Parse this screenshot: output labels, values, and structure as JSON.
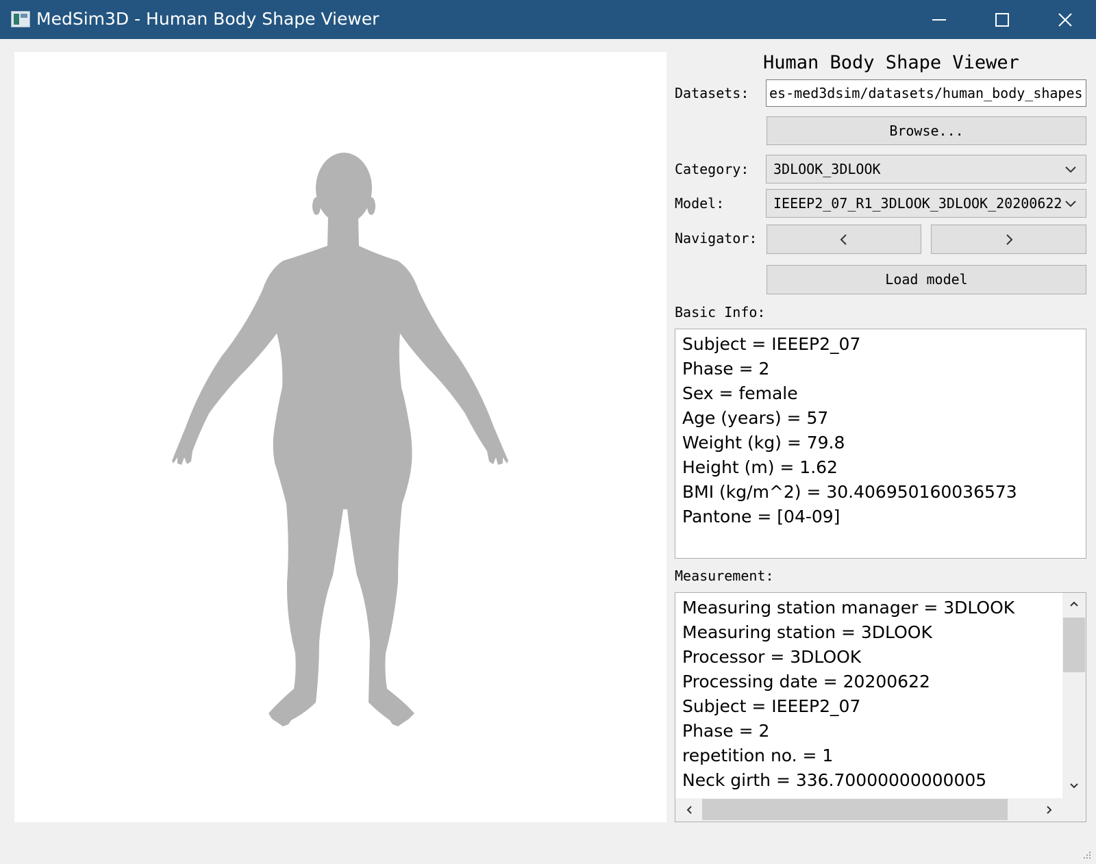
{
  "window": {
    "title": "MedSim3D - Human Body Shape Viewer",
    "titlebar_color": "#235580"
  },
  "panel": {
    "title": "Human Body Shape Viewer",
    "datasets_label": "Datasets:",
    "datasets_value": "es-med3dsim/datasets/human_body_shapes",
    "browse_label": "Browse...",
    "category_label": "Category:",
    "category_value": "3DLOOK_3DLOOK",
    "model_label": "Model:",
    "model_value": "IEEEP2_07_R1_3DLOOK_3DLOOK_20200622",
    "navigator_label": "Navigator:",
    "prev_label": "<",
    "next_label": ">",
    "load_label": "Load model"
  },
  "basic_info": {
    "label": "Basic Info:",
    "lines": [
      "Subject = IEEEP2_07",
      "Phase = 2",
      "Sex = female",
      "Age (years) = 57",
      "Weight (kg) = 79.8",
      "Height (m) = 1.62",
      "BMI (kg/m^2) = 30.406950160036573",
      "Pantone = [04-09]"
    ]
  },
  "measurement": {
    "label": "Measurement:",
    "lines": [
      "Measuring station manager = 3DLOOK",
      "Measuring station = 3DLOOK",
      "Processor = 3DLOOK",
      "Processing date = 20200622",
      "Subject = IEEEP2_07",
      "Phase = 2",
      "repetition no. = 1",
      "Neck girth = 336.70000000000005"
    ]
  },
  "colors": {
    "silhouette": "#b3b3b3",
    "viewport_bg": "#ffffff"
  },
  "icons": [
    "app-icon",
    "minimize-icon",
    "maximize-icon",
    "close-icon",
    "chevron-down-icon",
    "chevron-left-icon",
    "chevron-right-icon",
    "scroll-up-icon",
    "scroll-down-icon",
    "scroll-left-icon",
    "scroll-right-icon",
    "resize-grip-icon"
  ]
}
